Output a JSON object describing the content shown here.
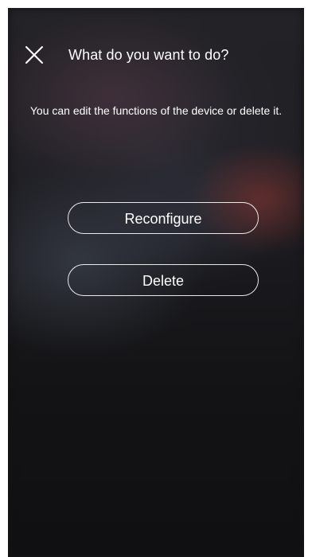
{
  "header": {
    "close_icon": "close-icon",
    "title": "What do you want to do?"
  },
  "main": {
    "description": "You can edit the functions of the device or delete it.",
    "actions": [
      {
        "label": "Reconfigure"
      },
      {
        "label": "Delete"
      }
    ]
  },
  "colors": {
    "background": "#141416",
    "text": "#ffffff",
    "button_border": "#ffffff"
  }
}
